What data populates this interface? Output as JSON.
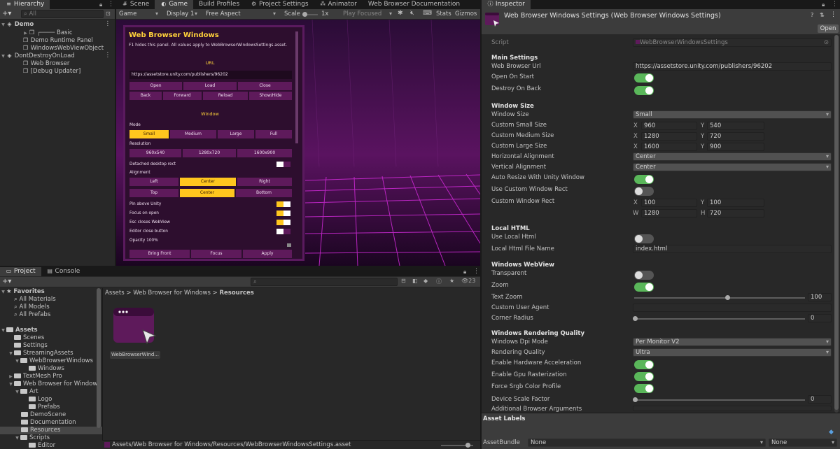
{
  "hierarchy": {
    "tab": "Hierarchy",
    "search_placeholder": "All",
    "items": [
      "Demo",
      "Basic",
      "Demo Runtime Panel",
      "WindowsWebViewObject",
      "DontDestroyOnLoad",
      "Web Browser",
      "[Debug Updater]"
    ]
  },
  "top_tabs": [
    "Scene",
    "Game",
    "Build Profiles",
    "Project Settings",
    "Animator",
    "Web Browser Documentation"
  ],
  "game_toolbar": {
    "mode": "Game",
    "display": "Display 1",
    "aspect": "Free Aspect",
    "scale_label": "Scale",
    "scale_value": "1x",
    "play_mode": "Play Focused",
    "stats": "Stats",
    "gizmos": "Gizmos"
  },
  "game_panel": {
    "title": "Web Browser Windows",
    "subtitle": "F1 hides this panel. All values apply to WebBrowserWindowsSettings.asset.",
    "url_section": "URL",
    "url_value": "https://assetstore.unity.com/publishers/96202",
    "url_buttons": [
      "Open",
      "Load",
      "Close",
      "Back",
      "Forward",
      "Reload",
      "Show/Hide"
    ],
    "window_section": "Window",
    "mode_label": "Mode",
    "mode_buttons": [
      "Small",
      "Medium",
      "Large",
      "Full"
    ],
    "resolution_label": "Resolution",
    "resolution_buttons": [
      "960x540",
      "1280x720",
      "1600x900"
    ],
    "detached_label": "Detached desktop rect",
    "alignment_label": "Alignment",
    "align_h": [
      "Left",
      "Center",
      "Right"
    ],
    "align_v": [
      "Top",
      "Center",
      "Bottom"
    ],
    "pin_label": "Pin above Unity",
    "focus_label": "Focus on open",
    "esc_label": "Esc closes WebView",
    "editor_close_label": "Editor close button",
    "opacity_label": "Opacity 100%",
    "bottom_buttons": [
      "Bring Front",
      "Focus",
      "Apply"
    ]
  },
  "project": {
    "tabs": [
      "Project",
      "Console"
    ],
    "search_count": "23",
    "favorites": {
      "label": "Favorites",
      "items": [
        "All Materials",
        "All Models",
        "All Prefabs"
      ]
    },
    "assets_label": "Assets",
    "tree": [
      "Scenes",
      "Settings",
      "StreamingAssets",
      "WebBrowserWindows",
      "Windows",
      "TextMesh Pro",
      "Web Browser for Windows",
      "Art",
      "Logo",
      "Prefabs",
      "DemoScene",
      "Documentation",
      "Resources",
      "Scripts",
      "Editor"
    ],
    "breadcrumb": [
      "Assets",
      "Web Browser for Windows",
      "Resources"
    ],
    "asset_name": "WebBrowserWind...",
    "footer_path": "Assets/Web Browser for Windows/Resources/WebBrowserWindowsSettings.asset"
  },
  "inspector": {
    "tab": "Inspector",
    "title": "Web Browser Windows Settings (Web Browser Windows Settings)",
    "open_button": "Open",
    "script_label": "Script",
    "script_value": "WebBrowserWindowsSettings",
    "main_settings": "Main Settings",
    "web_browser_url_label": "Web Browser Url",
    "web_browser_url_value": "https://assetstore.unity.com/publishers/96202",
    "open_on_start": "Open On Start",
    "destroy_on_back": "Destroy On Back",
    "window_size_header": "Window Size",
    "window_size_label": "Window Size",
    "window_size_value": "Small",
    "custom_small": "Custom Small Size",
    "custom_small_x": "960",
    "custom_small_y": "540",
    "custom_medium": "Custom Medium Size",
    "custom_medium_x": "1280",
    "custom_medium_y": "720",
    "custom_large": "Custom Large Size",
    "custom_large_x": "1600",
    "custom_large_y": "900",
    "h_align_label": "Horizontal Alignment",
    "h_align_value": "Center",
    "v_align_label": "Vertical Alignment",
    "v_align_value": "Center",
    "auto_resize": "Auto Resize With Unity Window",
    "use_custom_rect": "Use Custom Window Rect",
    "custom_rect": "Custom Window Rect",
    "rect_x": "100",
    "rect_y": "100",
    "rect_w": "1280",
    "rect_h": "720",
    "local_html_header": "Local HTML",
    "use_local_html": "Use Local Html",
    "local_html_file_label": "Local Html File Name",
    "local_html_file_value": "index.html",
    "webview_header": "Windows WebView",
    "transparent": "Transparent",
    "zoom": "Zoom",
    "text_zoom_label": "Text Zoom",
    "text_zoom_value": "100",
    "text_zoom_fraction": 0.55,
    "custom_user_agent": "Custom User Agent",
    "corner_radius_label": "Corner Radius",
    "corner_radius_value": "0",
    "rendering_header": "Windows Rendering Quality",
    "dpi_label": "Windows Dpi Mode",
    "dpi_value": "Per Monitor V2",
    "render_quality_label": "Rendering Quality",
    "render_quality_value": "Ultra",
    "hw_accel": "Enable Hardware Acceleration",
    "gpu_raster": "Enable Gpu Rasterization",
    "force_srgb": "Force Srgb Color Profile",
    "device_scale_label": "Device Scale Factor",
    "device_scale_value": "0",
    "additional_args": "Additional Browser Arguments",
    "asset_labels": "Asset Labels",
    "asset_bundle_label": "AssetBundle",
    "asset_bundle_value": "None",
    "asset_variant_value": "None"
  },
  "colors": {
    "accent_toggle": "#5ab75a",
    "game_yellow": "#ffc61e",
    "game_purple": "#5e1a5b"
  }
}
